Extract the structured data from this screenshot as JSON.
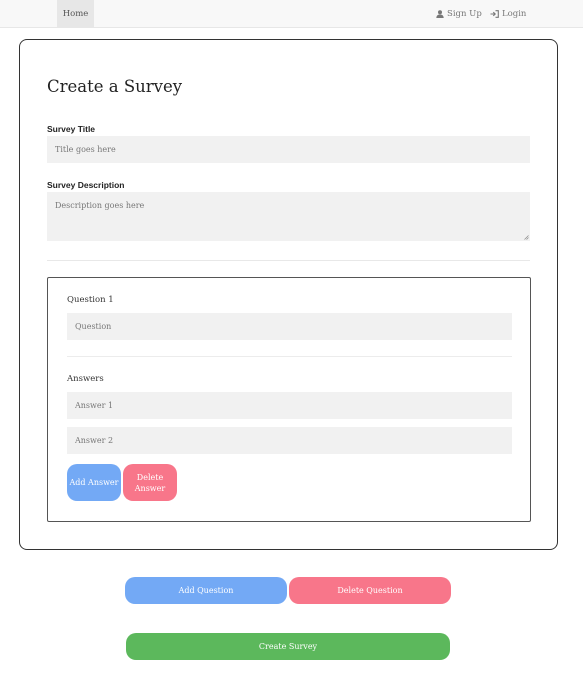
{
  "navbar": {
    "home_label": "Home",
    "signup_label": "Sign Up",
    "login_label": "Login"
  },
  "form": {
    "heading": "Create a Survey",
    "title_label": "Survey Title",
    "title_placeholder": "Title goes here",
    "title_value": "",
    "description_label": "Survey Description",
    "description_placeholder": "Description goes here",
    "description_value": ""
  },
  "question": {
    "label": "Question 1",
    "placeholder": "Question",
    "value": "",
    "answers_label": "Answers",
    "answers": [
      {
        "placeholder": "Answer 1",
        "value": ""
      },
      {
        "placeholder": "Answer 2",
        "value": ""
      }
    ],
    "add_answer_label": "Add Answer",
    "delete_answer_label": "Delete Answer"
  },
  "actions": {
    "add_question_label": "Add Question",
    "delete_question_label": "Delete Question",
    "create_survey_label": "Create Survey"
  },
  "colors": {
    "primary": "#73a9f5",
    "danger": "#f8768a",
    "success": "#5cb85c",
    "input_bg": "#f1f1f1"
  }
}
